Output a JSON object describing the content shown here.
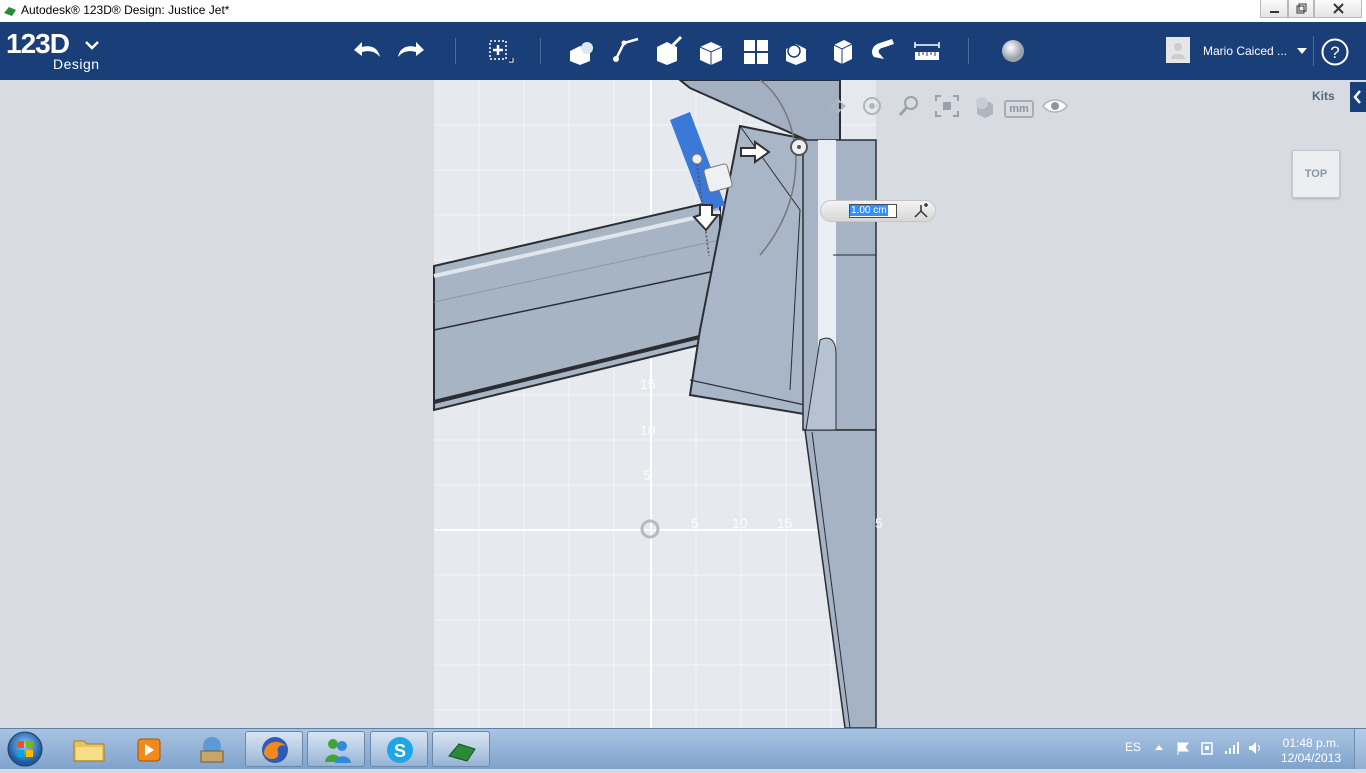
{
  "window": {
    "title": "Autodesk® 123D® Design: Justice Jet*"
  },
  "brand": {
    "logo": "123D",
    "sub": "Design"
  },
  "user": {
    "name": "Mario Caiced ..."
  },
  "kits_label": "Kits",
  "view_cube_label": "TOP",
  "view_controls": {
    "units_label": "mm"
  },
  "dimension": {
    "value": "1.00 cm"
  },
  "grid_labels": {
    "y": [
      "15",
      "10",
      "5"
    ],
    "x": [
      "5",
      "10",
      "15",
      "5"
    ]
  },
  "toolbar": {
    "icons": [
      "undo-icon",
      "redo-icon",
      "transform-icon",
      "primitives-icon",
      "sketch-icon",
      "construct-icon",
      "modify-icon",
      "pattern-icon",
      "grouping-icon",
      "combine-icon",
      "snap-icon",
      "measure-icon",
      "material-icon"
    ]
  },
  "taskbar": {
    "language": "ES",
    "time": "01:48 p.m.",
    "date": "12/04/2013",
    "apps": [
      "explorer",
      "media-player",
      "paint",
      "firefox",
      "messenger",
      "skype",
      "123d-design"
    ]
  },
  "colors": {
    "toolbar": "#1a3e78",
    "viewport": "#d8dce2",
    "model": "#a8b5c6",
    "selection": "#3c78d8"
  }
}
